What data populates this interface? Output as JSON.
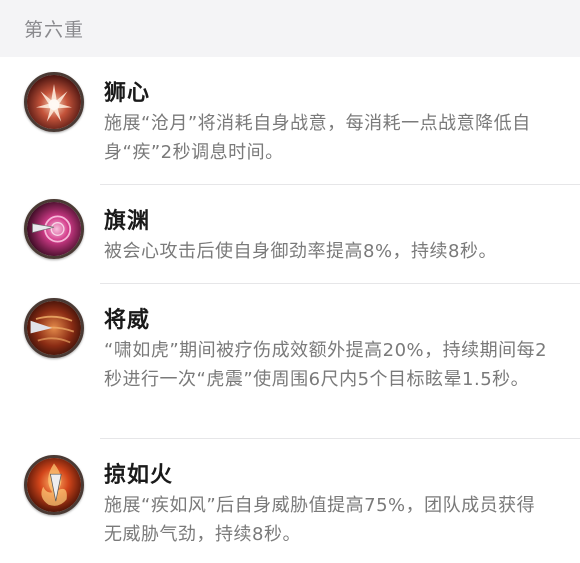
{
  "section": {
    "title": "第六重"
  },
  "talents": [
    {
      "name": "狮心",
      "description": "施展“沧月”将消耗自身战意，每消耗一点战意降低自身“疾”2秒调息时间。",
      "icon": "lion-heart-icon"
    },
    {
      "name": "旗渊",
      "description": "被会心攻击后使自身御劲率提高8%，持续8秒。",
      "icon": "banner-abyss-icon"
    },
    {
      "name": "将威",
      "description": "“啸如虎”期间被疗伤成效额外提高20%，持续期间每2秒进行一次“虎震”使周围6尺内5个目标眩晕1.5秒。",
      "icon": "general-might-icon"
    },
    {
      "name": "掠如火",
      "description": "施展“疾如风”后自身威胁值提高75%，团队成员获得无威胁气劲，持续8秒。",
      "icon": "plunder-fire-icon"
    }
  ]
}
